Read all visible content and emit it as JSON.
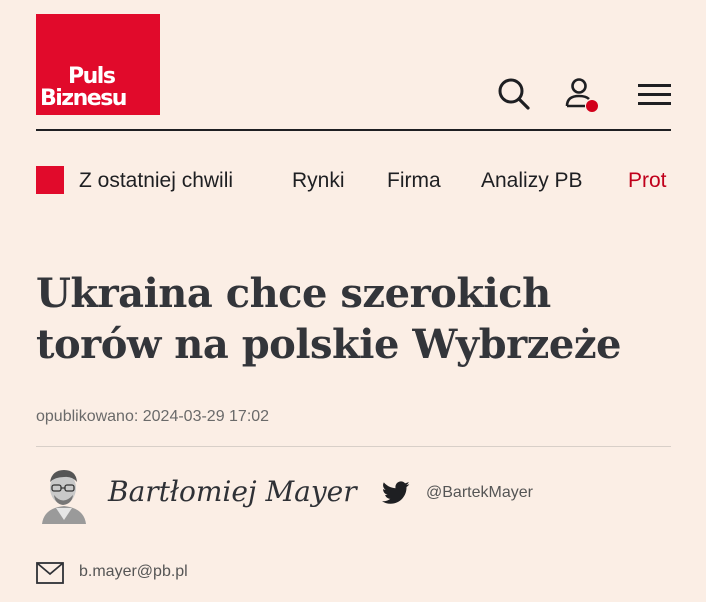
{
  "header": {
    "logo_line1": "Puls",
    "logo_line2": "Biznesu",
    "brand_color": "#e10a2b",
    "icons": [
      "search-icon",
      "user-icon",
      "menu-icon"
    ]
  },
  "nav": {
    "items": [
      {
        "label": "Z ostatniej chwili"
      },
      {
        "label": "Rynki"
      },
      {
        "label": "Firma"
      },
      {
        "label": "Analizy PB"
      },
      {
        "label": "Prot"
      }
    ],
    "accent_color": "#c0001b"
  },
  "article": {
    "title": "Ukraina chce szerokich torów na polskie Wybrzeże",
    "published": "opublikowano: 2024-03-29 17:02",
    "author": {
      "name": "Bartłomiej Mayer",
      "twitter_handle": "@BartekMayer",
      "email": "b.mayer@pb.pl"
    }
  }
}
